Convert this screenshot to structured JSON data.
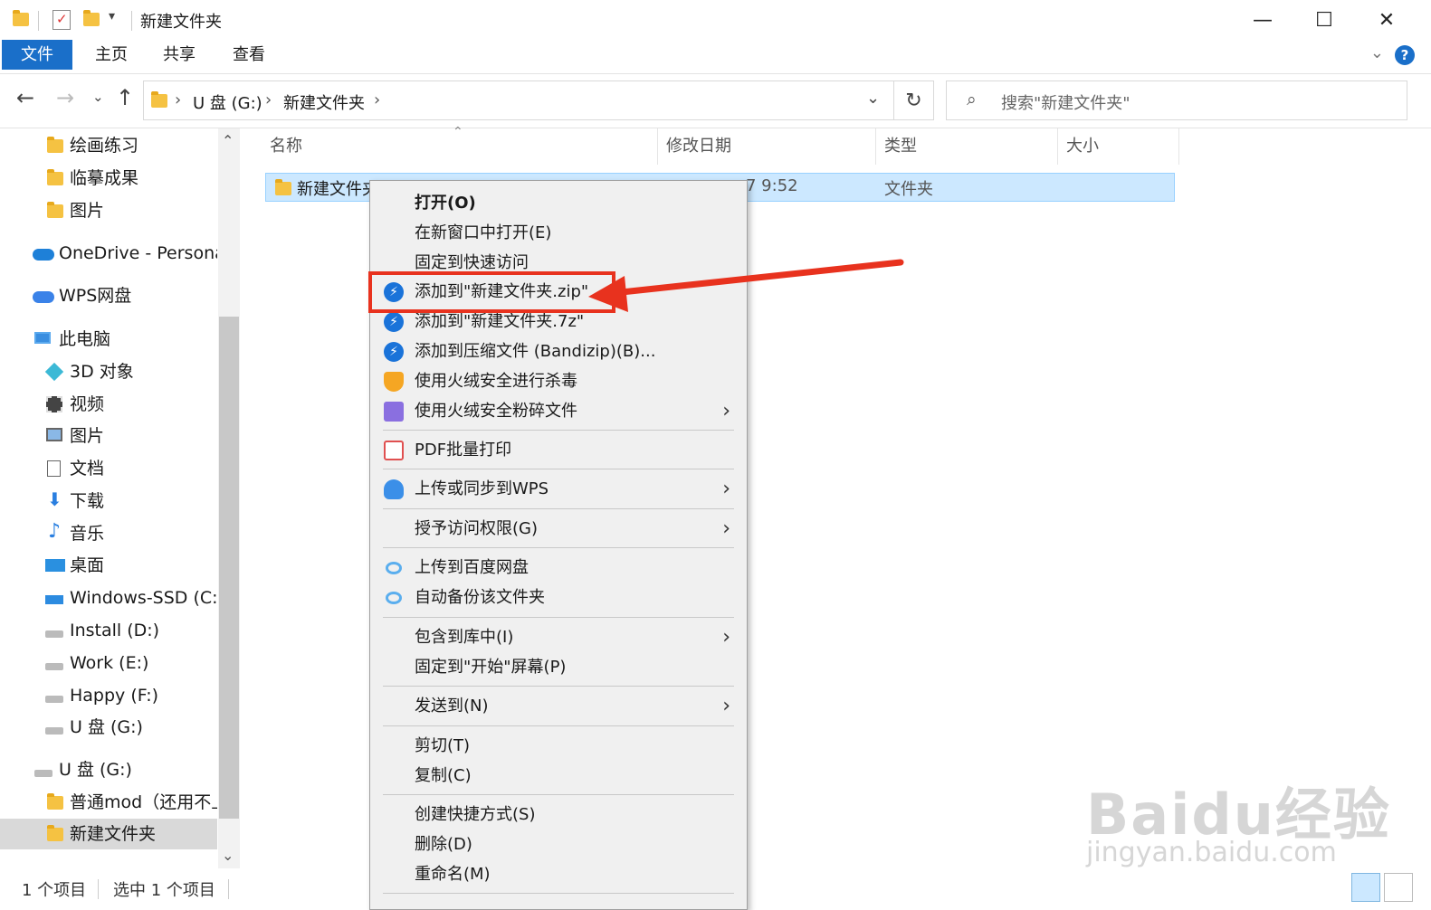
{
  "window": {
    "title": "新建文件夹",
    "controls": [
      "—",
      "☐",
      "✕"
    ]
  },
  "ribbon": {
    "tabs": [
      "文件",
      "主页",
      "共享",
      "查看"
    ],
    "help": "?",
    "collapse": "⌄"
  },
  "address": {
    "segments": [
      "U 盘 (G:)",
      "新建文件夹"
    ],
    "separator": "›",
    "search_placeholder": "搜索\"新建文件夹\""
  },
  "nav": {
    "items": [
      {
        "label": "绘画练习",
        "icon": "folder-icon"
      },
      {
        "label": "临摹成果",
        "icon": "folder-icon"
      },
      {
        "label": "图片",
        "icon": "folder-icon"
      },
      {
        "label": "OneDrive - Personal",
        "icon": "onedrive-icon"
      },
      {
        "label": "WPS网盘",
        "icon": "wps-cloud-icon"
      },
      {
        "label": "此电脑",
        "icon": "computer-icon"
      },
      {
        "label": "3D 对象",
        "icon": "3d-objects-icon"
      },
      {
        "label": "视频",
        "icon": "video-icon"
      },
      {
        "label": "图片",
        "icon": "pictures-icon"
      },
      {
        "label": "文档",
        "icon": "documents-icon"
      },
      {
        "label": "下载",
        "icon": "download-icon"
      },
      {
        "label": "音乐",
        "icon": "music-icon"
      },
      {
        "label": "桌面",
        "icon": "desktop-icon"
      },
      {
        "label": "Windows-SSD (C:)",
        "icon": "windows-drive-icon"
      },
      {
        "label": "Install (D:)",
        "icon": "drive-icon"
      },
      {
        "label": "Work (E:)",
        "icon": "drive-icon"
      },
      {
        "label": "Happy (F:)",
        "icon": "drive-icon"
      },
      {
        "label": "U 盘 (G:)",
        "icon": "drive-icon"
      },
      {
        "label": "U 盘 (G:)",
        "icon": "drive-icon"
      },
      {
        "label": "普通mod（还用不上",
        "icon": "folder-icon"
      },
      {
        "label": "新建文件夹",
        "icon": "folder-icon"
      }
    ]
  },
  "columns": [
    "名称",
    "修改日期",
    "类型",
    "大小"
  ],
  "files": [
    {
      "name": "新建文件夹",
      "modified": "7 9:52",
      "type": "文件夹",
      "size": ""
    }
  ],
  "context_menu": {
    "items": [
      {
        "label": "打开(O)",
        "icon": ""
      },
      {
        "label": "在新窗口中打开(E)",
        "icon": ""
      },
      {
        "label": "固定到快速访问",
        "icon": ""
      },
      {
        "label": "添加到\"新建文件夹.zip\"",
        "icon": "bandizip-icon"
      },
      {
        "label": "添加到\"新建文件夹.7z\"",
        "icon": "bandizip-icon"
      },
      {
        "label": "添加到压缩文件 (Bandizip)(B)...",
        "icon": "bandizip-icon"
      },
      {
        "label": "使用火绒安全进行杀毒",
        "icon": "huorong-icon"
      },
      {
        "label": "使用火绒安全粉碎文件",
        "icon": "shredder-icon"
      },
      {
        "label": "PDF批量打印",
        "icon": "pdf-print-icon"
      },
      {
        "label": "上传或同步到WPS",
        "icon": "wps-upload-icon"
      },
      {
        "label": "授予访问权限(G)",
        "icon": ""
      },
      {
        "label": "上传到百度网盘",
        "icon": "baidu-netdisk-icon"
      },
      {
        "label": "自动备份该文件夹",
        "icon": "baidu-netdisk-icon"
      },
      {
        "label": "包含到库中(I)",
        "icon": ""
      },
      {
        "label": "固定到\"开始\"屏幕(P)",
        "icon": ""
      },
      {
        "label": "发送到(N)",
        "icon": ""
      },
      {
        "label": "剪切(T)",
        "icon": ""
      },
      {
        "label": "复制(C)",
        "icon": ""
      },
      {
        "label": "创建快捷方式(S)",
        "icon": ""
      },
      {
        "label": "删除(D)",
        "icon": ""
      },
      {
        "label": "重命名(M)",
        "icon": ""
      }
    ],
    "submenu_glyph": "›"
  },
  "status": {
    "count": "1 个项目",
    "selected": "选中 1 个项目"
  },
  "watermark": {
    "brand": "Baidu经验",
    "url": "jingyan.baidu.com"
  },
  "colors": {
    "accent": "#1a6fc9",
    "selection": "#cce8ff",
    "annotation": "#e8321e"
  }
}
